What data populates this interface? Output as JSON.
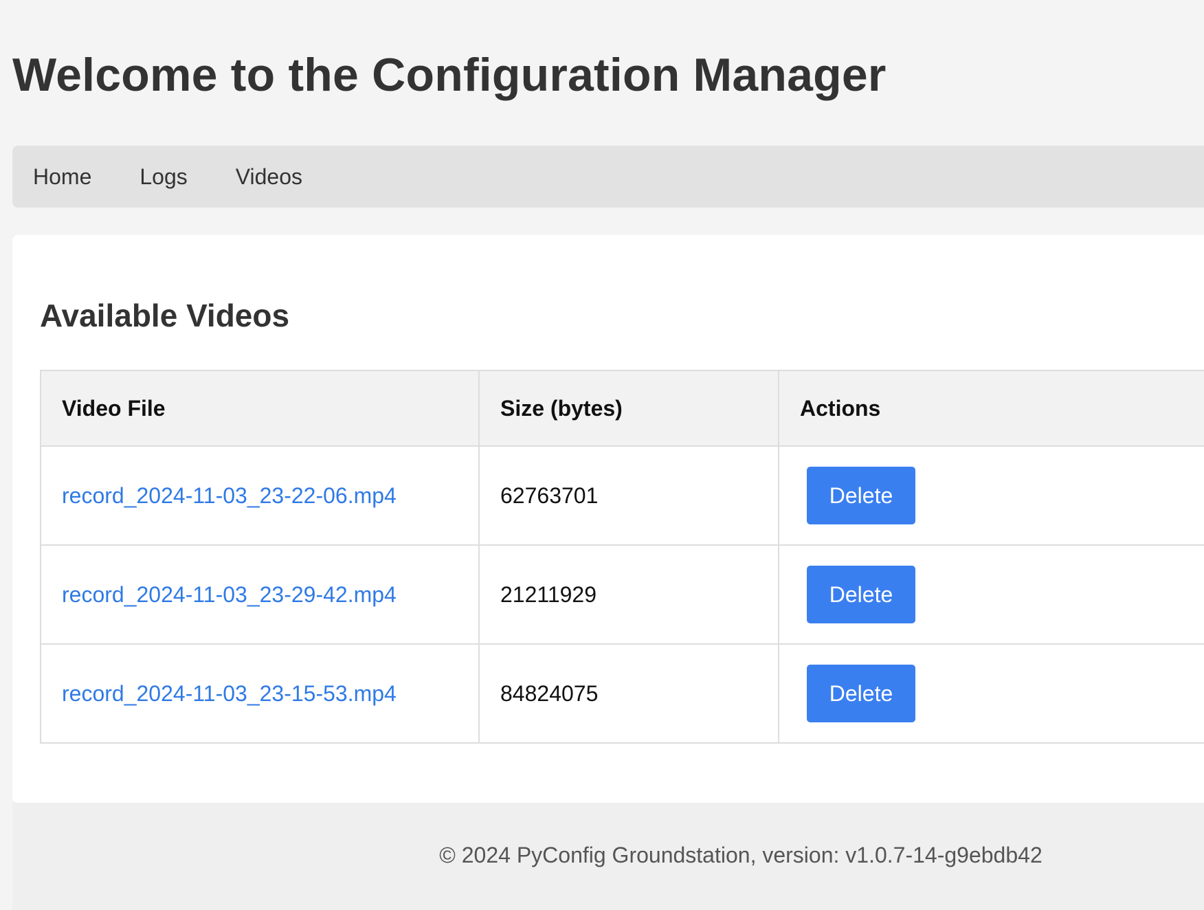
{
  "header": {
    "title": "Welcome to the Configuration Manager"
  },
  "nav": {
    "items": [
      {
        "label": "Home"
      },
      {
        "label": "Logs"
      },
      {
        "label": "Videos"
      }
    ]
  },
  "main": {
    "section_title": "Available Videos",
    "table": {
      "columns": [
        "Video File",
        "Size (bytes)",
        "Actions"
      ],
      "rows": [
        {
          "file": "record_2024-11-03_23-22-06.mp4",
          "size": "62763701",
          "action": "Delete"
        },
        {
          "file": "record_2024-11-03_23-29-42.mp4",
          "size": "21211929",
          "action": "Delete"
        },
        {
          "file": "record_2024-11-03_23-15-53.mp4",
          "size": "84824075",
          "action": "Delete"
        }
      ]
    }
  },
  "footer": {
    "text": "© 2024 PyConfig Groundstation, version: v1.0.7-14-g9ebdb42"
  },
  "colors": {
    "link": "#2f7ae5",
    "button": "#3a7ff0",
    "nav_background": "#e2e2e2",
    "page_background": "#f4f4f4"
  }
}
